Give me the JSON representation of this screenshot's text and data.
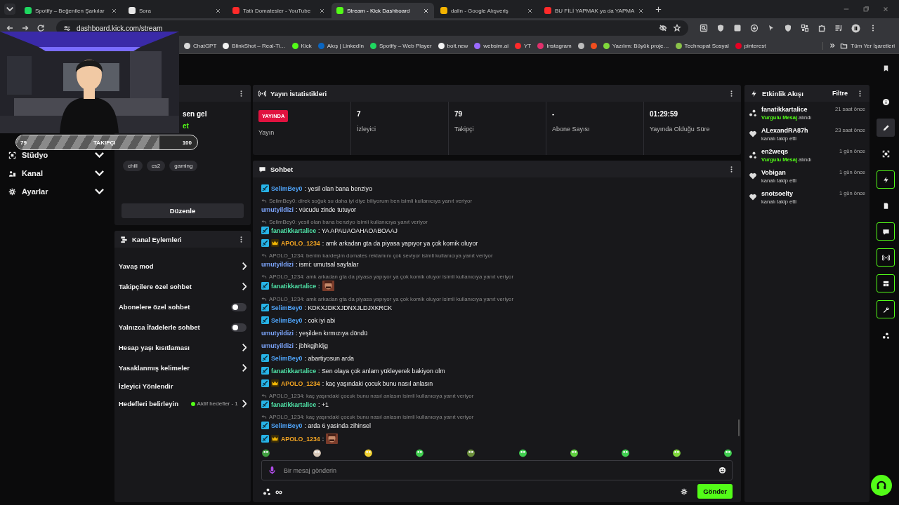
{
  "browser": {
    "tabs": [
      {
        "title": "Spotify – Beğenilen Şarkılar",
        "selected": false,
        "color": "#1ed760"
      },
      {
        "title": "Sora",
        "selected": false,
        "color": "#e8e8e8"
      },
      {
        "title": "Tatlı Domatesler - YouTube",
        "selected": false,
        "color": "#ff2a2a"
      },
      {
        "title": "Stream - Kick Dashboard",
        "selected": true,
        "color": "#53fc18"
      },
      {
        "title": "dalin - Google Alışveriş",
        "selected": false,
        "color": "#f4b400"
      },
      {
        "title": "BU FİLİ YAPMAK ya da YAPMA",
        "selected": false,
        "color": "#ff2a2a"
      }
    ],
    "url": "dashboard.kick.com/stream",
    "bookmarks": [
      {
        "label": "ChatGPT",
        "color": "#d9d9d9"
      },
      {
        "label": "BlinkShot – Real-Ti…",
        "color": "#f2f2f2"
      },
      {
        "label": "Kick",
        "color": "#53fc18"
      },
      {
        "label": "Akış | LinkedIn",
        "color": "#0a66c2"
      },
      {
        "label": "Spotify – Web Player",
        "color": "#1ed760"
      },
      {
        "label": "bolt.new",
        "color": "#f2f2f2"
      },
      {
        "label": "websim.ai",
        "color": "#9b6bff"
      },
      {
        "label": "YT",
        "color": "#ff2a2a"
      },
      {
        "label": "Instagram",
        "color": "#e1306c"
      },
      {
        "color": "#bdbdbd"
      },
      {
        "color": "#f24e1e"
      },
      {
        "label": "Yazılım: Büyük proje…",
        "color": "#7fd83b"
      },
      {
        "label": "Technopat Sosyal",
        "color": "#8bc34a"
      },
      {
        "label": "pinterest",
        "color": "#e60023"
      }
    ],
    "all_bookmarks": "Tüm Yer İşaretleri"
  },
  "webcam": {
    "kind": "picture",
    "goal": {
      "current": "79",
      "label": "TAKIPÇI",
      "target": "100",
      "level": 0.79
    }
  },
  "sidebar": {
    "items": [
      {
        "label": "Stüdyo",
        "expanded": false
      },
      {
        "label": "Kanal",
        "expanded": false
      },
      {
        "label": "Ayarlar",
        "expanded": false
      }
    ]
  },
  "stream_info": {
    "title": "sen gel",
    "subtitle": "et",
    "tags": [
      "chill",
      "cs2",
      "gaming"
    ],
    "edit_button": "Düzenle"
  },
  "channel_actions": {
    "title": "Kanal Eylemleri",
    "items": [
      {
        "label": "Yavaş mod",
        "kind": "link"
      },
      {
        "label": "Takipçilere özel sohbet",
        "kind": "link"
      },
      {
        "label": "Abonelere özel sohbet",
        "kind": "toggle",
        "on": false
      },
      {
        "label": "Yalnızca İfadelerle sohbet",
        "kind": "toggle",
        "on": false
      },
      {
        "label": "Hesap yaşı kısıtlaması",
        "kind": "link"
      },
      {
        "label": "Yasaklanmış kelimeler",
        "kind": "link"
      },
      {
        "label": "İzleyici Yönlendir",
        "kind": "plain"
      },
      {
        "label": "Hedefleri belirleyin",
        "kind": "link",
        "status": "Aktif hedefler - 1"
      }
    ]
  },
  "stats": {
    "title": "Yayın İstatistikleri",
    "live_badge": "YAYINDA",
    "live_label": "Yayın",
    "items": [
      {
        "value": "7",
        "label": "İzleyici"
      },
      {
        "value": "79",
        "label": "Takipçi"
      },
      {
        "value": "-",
        "label": "Abone Sayısı"
      },
      {
        "value": "01:29:59",
        "label": "Yayında Olduğu Süre"
      }
    ]
  },
  "chat": {
    "title": "Sohbet",
    "messages": [
      {
        "kind": "text",
        "mod": true,
        "crown": false,
        "user": "SelimBey0",
        "color": "#4fa3f7",
        "text": ": yesil olan bana benziyo"
      },
      {
        "kind": "text",
        "reply_to": "SelimBey0: direk soğuk su daha iyi diye biliyorum ben isimli kullanıcıya yanıt veriyor",
        "mod": false,
        "crown": false,
        "user": "umutyildizi",
        "color": "#7aa2f7",
        "text": ": vücudu zinde tutuyor"
      },
      {
        "kind": "text",
        "reply_to": "SelimBey0: yesil olan bana benziyo isimli kullanıcıya yanıt veriyor",
        "mod": true,
        "crown": false,
        "user": "fanatikkartalice",
        "color": "#4fe0a6",
        "text": ": YA APAUAOAHAOABOAAJ"
      },
      {
        "kind": "text",
        "mod": true,
        "crown": true,
        "user": "APOLO_1234",
        "color": "#f5a623",
        "text": ": amk arkadan gta da piyasa yapıyor ya çok komik oluyor"
      },
      {
        "kind": "text",
        "reply_to": "APOLO_1234: benim kardeşim domates reklamını çok seviyor isimli kullanıcıya yanıt veriyor",
        "mod": false,
        "crown": false,
        "user": "umutyildizi",
        "color": "#7aa2f7",
        "text": ": ismi: umutsal sayfalar"
      },
      {
        "kind": "emote",
        "reply_to": "APOLO_1234: amk arkadan gta da piyasa yapıyor ya çok komik oluyor isimli kullanıcıya yanıt veriyor",
        "mod": true,
        "crown": false,
        "user": "fanatikkartalice",
        "color": "#4fe0a6",
        "text": ":"
      },
      {
        "kind": "text",
        "reply_to": "APOLO_1234: amk arkadan gta da piyasa yapıyor ya çok komik oluyor isimli kullanıcıya yanıt veriyor",
        "mod": true,
        "crown": false,
        "user": "SelimBey0",
        "color": "#4fa3f7",
        "text": ": KDKXJDKXJDNXJLDJXKRCK"
      },
      {
        "kind": "text",
        "mod": true,
        "crown": false,
        "user": "SelimBey0",
        "color": "#4fa3f7",
        "text": ": cok iyi abi"
      },
      {
        "kind": "text",
        "mod": false,
        "crown": false,
        "user": "umutyildizi",
        "color": "#7aa2f7",
        "text": ": yeşilden kırmızıya döndü"
      },
      {
        "kind": "text",
        "mod": false,
        "crown": false,
        "user": "umutyildizi",
        "color": "#7aa2f7",
        "text": ": jbhkgjhkljg"
      },
      {
        "kind": "text",
        "mod": true,
        "crown": false,
        "user": "SelimBey0",
        "color": "#4fa3f7",
        "text": ": abartiyosun arda"
      },
      {
        "kind": "text",
        "mod": true,
        "crown": false,
        "user": "fanatikkartalice",
        "color": "#4fe0a6",
        "text": ": Sen olaya çok anlam yükleyerek bakiyon olm"
      },
      {
        "kind": "text",
        "mod": true,
        "crown": true,
        "user": "APOLO_1234",
        "color": "#f5a623",
        "text": ": kaç yaşındaki çocuk bunu nasıl anlasın"
      },
      {
        "kind": "text",
        "reply_to": "APOLO_1234: kaç yaşındaki çocuk bunu nasıl anlasın isimli kullanıcıya yanıt veriyor",
        "mod": true,
        "crown": false,
        "user": "fanatikkartalice",
        "color": "#4fe0a6",
        "text": ": +1"
      },
      {
        "kind": "text",
        "reply_to": "APOLO_1234: kaç yaşındaki çocuk bunu nasıl anlasın isimli kullanıcıya yanıt veriyor",
        "mod": true,
        "crown": false,
        "user": "SelimBey0",
        "color": "#4fa3f7",
        "text": ": arda 6 yasinda zihinsel"
      },
      {
        "kind": "emote",
        "mod": true,
        "crown": true,
        "user": "APOLO_1234",
        "color": "#f5a623",
        "text": ":"
      }
    ],
    "placeholder": "Bir mesaj gönderin",
    "infinity": "∞",
    "send_button": "Gönder"
  },
  "events": {
    "title": "Etkinlik Akışı",
    "filter": "Filtre",
    "items": [
      {
        "kind": "highlight",
        "name": "fanatikkartalice",
        "action": "**Vurgulu Mesaj** alındı",
        "time": "21 saat önce"
      },
      {
        "kind": "follow",
        "name": "ALexandRA87h",
        "action": "kanalı takip etti",
        "time": "23 saat önce"
      },
      {
        "kind": "highlight",
        "name": "en2weqs",
        "action": "**Vurgulu Mesaj** alındı",
        "time": "1 gün önce"
      },
      {
        "kind": "follow",
        "name": "Vobigan",
        "action": "kanalı takip etti",
        "time": "1 gün önce"
      },
      {
        "kind": "follow",
        "name": "snotsoelty",
        "action": "kanalı takip etti",
        "time": "1 gün önce"
      }
    ]
  },
  "rail": {
    "items": [
      {
        "selected": false,
        "outlined": false
      },
      {
        "selected": true,
        "outlined": false
      },
      {
        "selected": false,
        "outlined": false
      },
      {
        "selected": false,
        "outlined": true
      },
      {
        "selected": false,
        "outlined": false
      },
      {
        "selected": false,
        "outlined": true
      },
      {
        "selected": false,
        "outlined": true
      },
      {
        "selected": false,
        "outlined": true
      },
      {
        "selected": false,
        "outlined": true
      },
      {
        "selected": false,
        "outlined": false
      }
    ]
  }
}
